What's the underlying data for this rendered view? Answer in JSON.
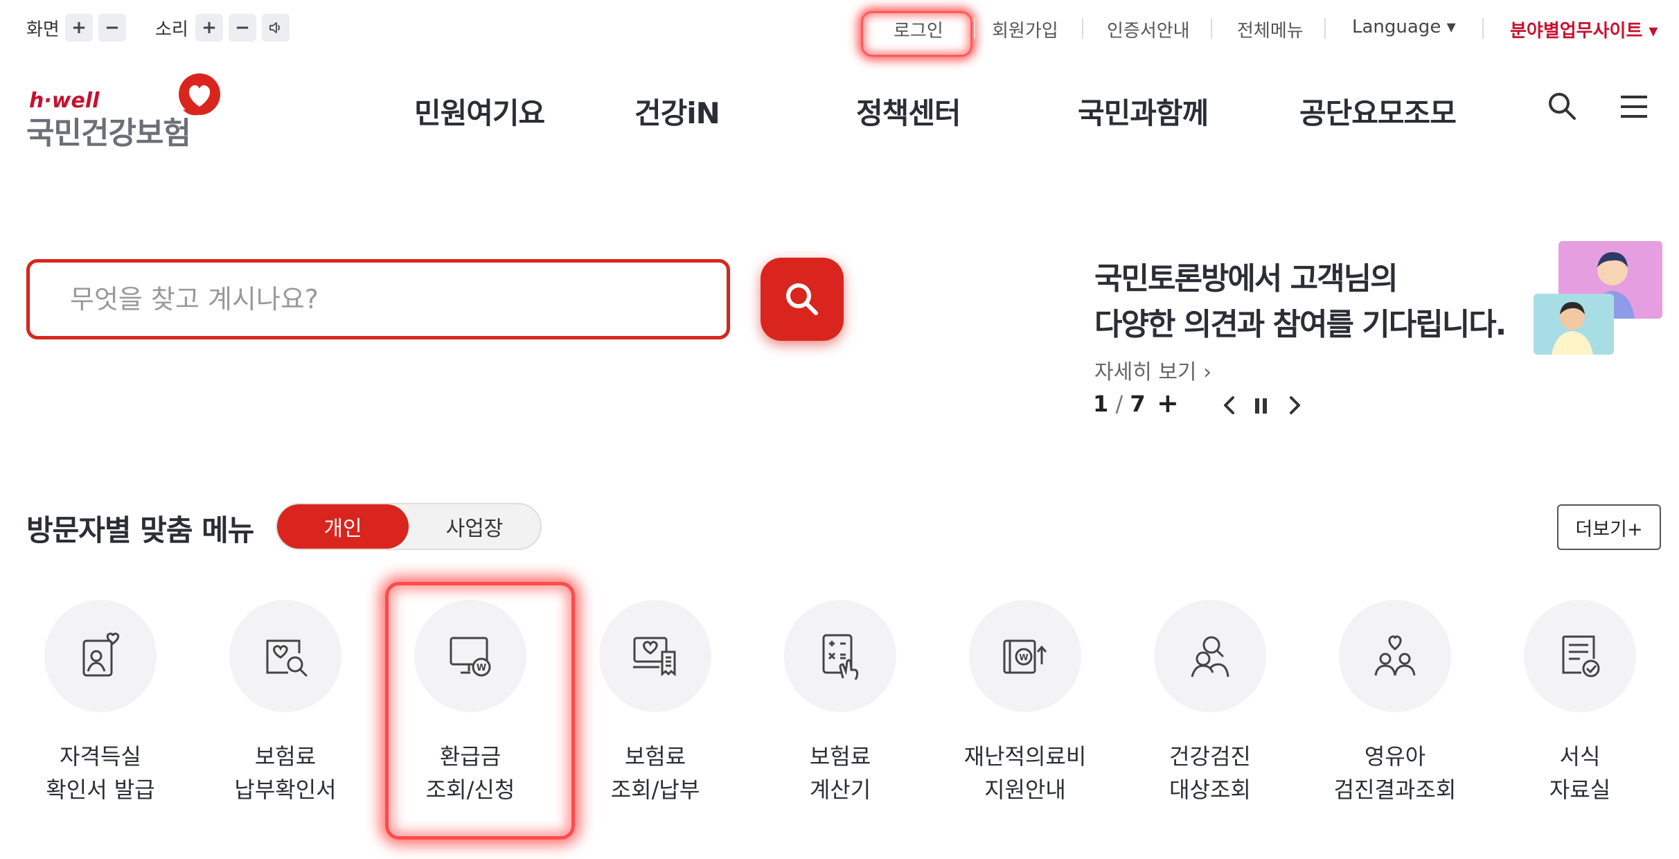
{
  "utility": {
    "screen_label": "화면",
    "sound_label": "소리",
    "plus": "+",
    "minus": "−",
    "links": {
      "login": "로그인",
      "signup": "회원가입",
      "cert": "인증서안내",
      "allmenu": "전체메뉴",
      "language": "Language ▾",
      "sites": "분야별업무사이트 ▾"
    }
  },
  "logo": {
    "brand": "h·well",
    "name": "국민건강보험"
  },
  "nav": [
    "민원여기요",
    "건강iN",
    "정책센터",
    "국민과함께",
    "공단요모조모"
  ],
  "search": {
    "placeholder": "무엇을 찾고 계시나요?"
  },
  "banner": {
    "line1": "국민토론방에서 고객님의",
    "line2": "다양한 의견과 참여를 기다립니다.",
    "more": "자세히 보기 ›",
    "current": "1",
    "total": "7",
    "plus": "+"
  },
  "visitor_menu": {
    "title": "방문자별 맞춤 메뉴",
    "tab_on": "개인",
    "tab_off": "사업장",
    "more": "더보기+",
    "items": [
      {
        "line1": "자격득실",
        "line2": "확인서 발급",
        "icon": "id-card-heart-icon"
      },
      {
        "line1": "보험료",
        "line2": "납부확인서",
        "icon": "document-search-icon"
      },
      {
        "line1": "환급금",
        "line2": "조회/신청",
        "icon": "monitor-won-icon"
      },
      {
        "line1": "보험료",
        "line2": "조회/납부",
        "icon": "monitor-receipt-icon"
      },
      {
        "line1": "보험료",
        "line2": "계산기",
        "icon": "calculator-hand-icon"
      },
      {
        "line1": "재난적의료비",
        "line2": "지원안내",
        "icon": "won-book-icon"
      },
      {
        "line1": "건강검진",
        "line2": "대상조회",
        "icon": "person-search-icon"
      },
      {
        "line1": "영유아",
        "line2": "검진결과조회",
        "icon": "family-heart-icon"
      },
      {
        "line1": "서식",
        "line2": "자료실",
        "icon": "form-check-icon"
      }
    ]
  },
  "colors": {
    "accent": "#d9251d",
    "text": "#2b2e35",
    "circle_bg": "#f3f3f5"
  }
}
